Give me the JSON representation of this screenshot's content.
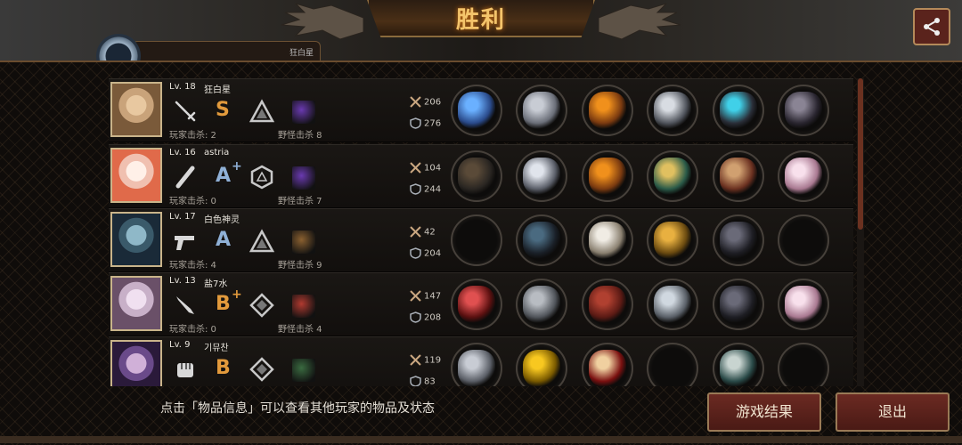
{
  "header": {
    "title": "胜利",
    "tab_label": "狂白星"
  },
  "players": [
    {
      "level": "Lv. 18",
      "name": "狂白星",
      "grade": "S",
      "grade_plus": "",
      "grade_color": "#e29a3c",
      "player_kills_label": "玩家击杀: 2",
      "monster_kills_label": "野怪击杀 8",
      "attack": "206",
      "defense": "276",
      "weapon_icon": "rapier-icon",
      "rank_icon": "triangle-rank-icon",
      "monster_icon": "purple-beast-icon",
      "items": [
        "blue-sword-item",
        "steel-helmet-item",
        "flame-armor-item",
        "round-shield-item",
        "blue-boots-item",
        "dark-cape-item"
      ]
    },
    {
      "level": "Lv. 16",
      "name": "astria",
      "grade": "A",
      "grade_plus": "+",
      "grade_color": "#8fb0d6",
      "player_kills_label": "玩家击杀: 0",
      "monster_kills_label": "野怪击杀 7",
      "attack": "104",
      "defense": "244",
      "weapon_icon": "bat-icon",
      "rank_icon": "hexagon-rank-icon",
      "monster_icon": "purple-beast-icon",
      "items": [
        "umbrella-item",
        "tiara-item",
        "flame-armor-item",
        "jade-bracelet-item",
        "bracer-item",
        "pearl-item"
      ]
    },
    {
      "level": "Lv. 17",
      "name": "白色神灵",
      "grade": "A",
      "grade_plus": "",
      "grade_color": "#8fb0d6",
      "player_kills_label": "玩家击杀: 4",
      "monster_kills_label": "野怪击杀 9",
      "attack": "42",
      "defense": "204",
      "weapon_icon": "pistol-icon",
      "rank_icon": "triangle-rank-icon",
      "monster_icon": "claw-beast-icon",
      "items": [
        "",
        "dark-helmet-item",
        "white-armor-item",
        "gold-shield-item",
        "gauntlet-item",
        ""
      ]
    },
    {
      "level": "Lv. 13",
      "name": "盐7水",
      "grade": "B",
      "grade_plus": "+",
      "grade_color": "#e29a3c",
      "player_kills_label": "玩家击杀: 0",
      "monster_kills_label": "野怪击杀 4",
      "attack": "147",
      "defense": "208",
      "weapon_icon": "knife-icon",
      "rank_icon": "diamond-rank-icon",
      "monster_icon": "red-beast-icon",
      "items": [
        "red-blade-item",
        "knight-helmet-item",
        "red-armor-item",
        "spiked-bracer-item",
        "gauntlet-item",
        "pearl-item"
      ]
    },
    {
      "level": "Lv. 9",
      "name": "기뮤찬",
      "grade": "B",
      "grade_plus": "",
      "grade_color": "#e29a3c",
      "player_kills_label": "",
      "monster_kills_label": "",
      "attack": "119",
      "defense": "83",
      "weapon_icon": "fist-icon",
      "rank_icon": "diamond-rank-icon",
      "monster_icon": "green-beast-icon",
      "items": [
        "metal-glove-item",
        "hard-hat-item",
        "red-bandage-item",
        "",
        "sneaker-item",
        ""
      ]
    }
  ],
  "footer": {
    "hint": "点击「物品信息」可以查看其他玩家的物品及状态",
    "result_button": "游戏结果",
    "exit_button": "退出"
  },
  "colors": {
    "accent": "#f4c46b",
    "button_bg": "#5a231c",
    "button_border": "#9a7a56"
  }
}
